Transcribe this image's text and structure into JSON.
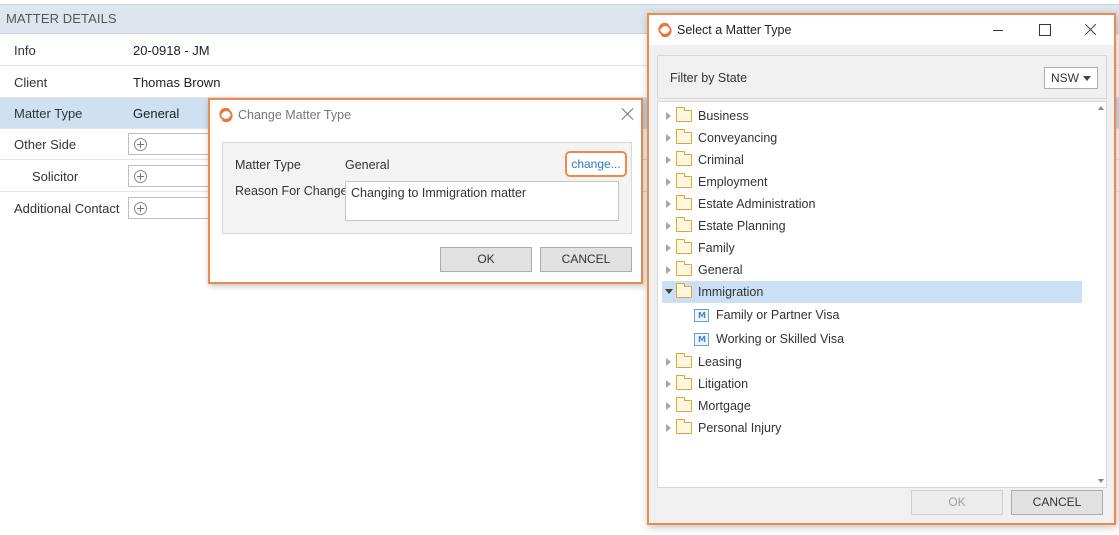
{
  "matter_details": {
    "header": "MATTER DETAILS",
    "rows": [
      {
        "label": "Info",
        "value": "20-0918 - JM"
      },
      {
        "label": "Client",
        "value": "Thomas Brown"
      },
      {
        "label": "Matter Type",
        "value": "General"
      },
      {
        "label": "Other Side",
        "value": ""
      },
      {
        "label": "Solicitor",
        "value": ""
      },
      {
        "label": "Additional Contact",
        "value": ""
      }
    ]
  },
  "change_dialog": {
    "title": "Change Matter Type",
    "matter_type_label": "Matter Type",
    "matter_type_value": "General",
    "change_link": "change...",
    "reason_label": "Reason For Change",
    "reason_value": "Changing to Immigration matter",
    "ok_label": "OK",
    "cancel_label": "CANCEL"
  },
  "select_window": {
    "title": "Select a Matter Type",
    "filter_label": "Filter by State",
    "state_value": "NSW",
    "tree": [
      {
        "label": "Business"
      },
      {
        "label": "Conveyancing"
      },
      {
        "label": "Criminal"
      },
      {
        "label": "Employment"
      },
      {
        "label": "Estate Administration"
      },
      {
        "label": "Estate Planning"
      },
      {
        "label": "Family"
      },
      {
        "label": "General"
      },
      {
        "label": "Immigration",
        "children": [
          "Family or Partner Visa",
          "Working or Skilled Visa"
        ]
      },
      {
        "label": "Leasing"
      },
      {
        "label": "Litigation"
      },
      {
        "label": "Mortgage"
      },
      {
        "label": "Personal Injury"
      }
    ],
    "ok_label": "OK",
    "cancel_label": "CANCEL"
  },
  "colors": {
    "accent_border": "#f08a4b",
    "selected_row": "#cce0f5",
    "link": "#2f75c6",
    "header_bg": "#dde6ef"
  }
}
